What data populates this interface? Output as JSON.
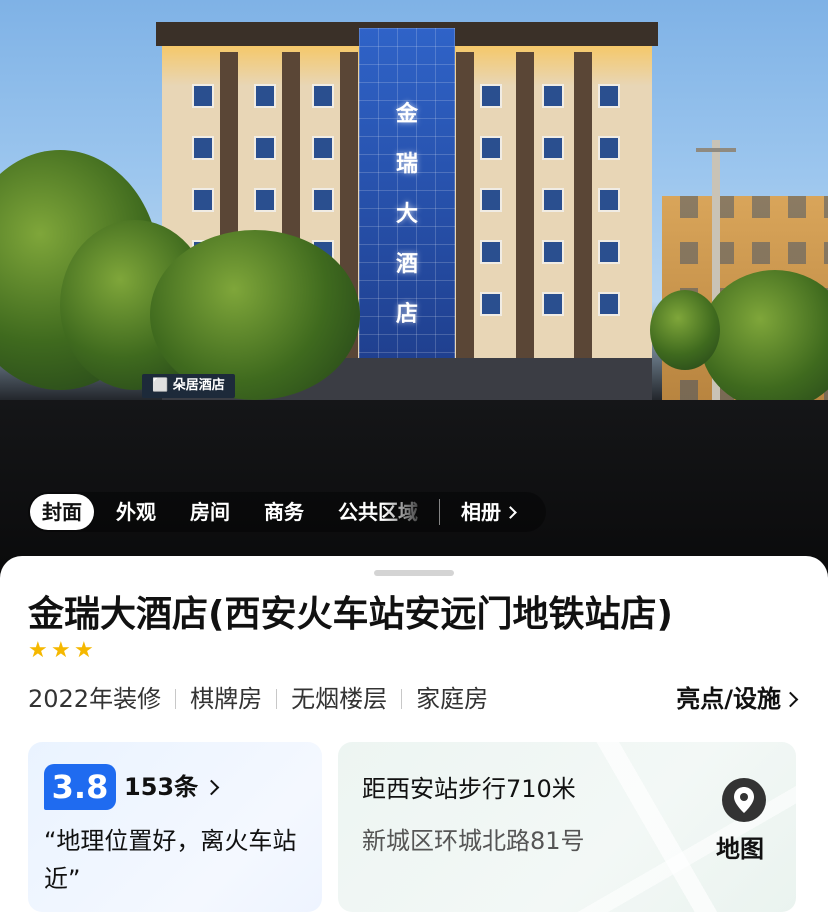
{
  "hero": {
    "building_sign": [
      "金",
      "瑞",
      "大",
      "酒",
      "店"
    ],
    "store_sign": "⬜ 朵居酒店"
  },
  "photo_tabs": [
    {
      "label": "封面",
      "active": true
    },
    {
      "label": "外观",
      "active": false
    },
    {
      "label": "房间",
      "active": false
    },
    {
      "label": "商务",
      "active": false
    },
    {
      "label": "公共区域",
      "active": false
    }
  ],
  "album_label": "相册",
  "hotel": {
    "name": "金瑞大酒店(西安火车站安远门地铁站店)",
    "star_rating": 3,
    "tags": [
      "2022年装修",
      "棋牌房",
      "无烟楼层",
      "家庭房"
    ],
    "highlights_label": "亮点/设施"
  },
  "review": {
    "score": "3.8",
    "count": "153条",
    "quote": "“地理位置好，离火车站近”"
  },
  "location": {
    "distance": "距西安站步行710米",
    "address": "新城区环城北路81号",
    "map_label": "地图"
  },
  "colors": {
    "accent": "#1f6bf0",
    "star": "#f5b800"
  },
  "icons": {
    "star": "star-icon",
    "chevron": "chevron-right-icon",
    "map": "map-pin-icon"
  }
}
